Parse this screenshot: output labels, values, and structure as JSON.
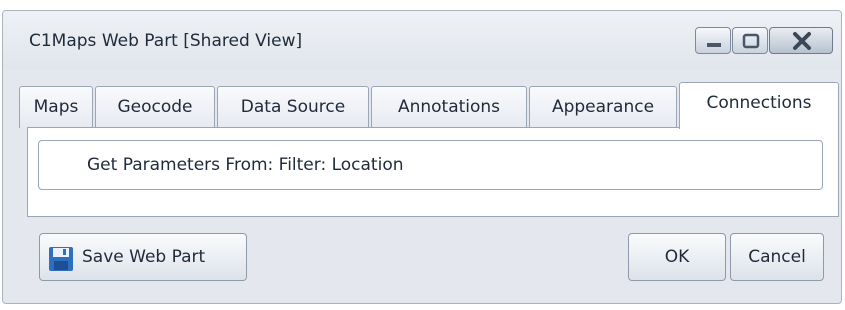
{
  "window": {
    "title": "C1Maps Web Part [Shared View]"
  },
  "tabs": [
    {
      "label": "Maps"
    },
    {
      "label": "Geocode"
    },
    {
      "label": "Data Source"
    },
    {
      "label": "Annotations"
    },
    {
      "label": "Appearance"
    },
    {
      "label": "Connections",
      "active": true
    }
  ],
  "connections": {
    "parameters_text": "Get Parameters From: Filter: Location"
  },
  "footer": {
    "save_label": "Save Web Part",
    "ok_label": "OK",
    "cancel_label": "Cancel"
  },
  "icons": {
    "minimize": "minimize-icon",
    "maximize": "maximize-icon",
    "close": "close-icon",
    "save": "floppy-disk-icon"
  },
  "colors": {
    "window_background": "#e4e8ee",
    "border": "#9aa6b6",
    "text": "#1f2a3a",
    "save_icon": "#2f6fc0"
  }
}
